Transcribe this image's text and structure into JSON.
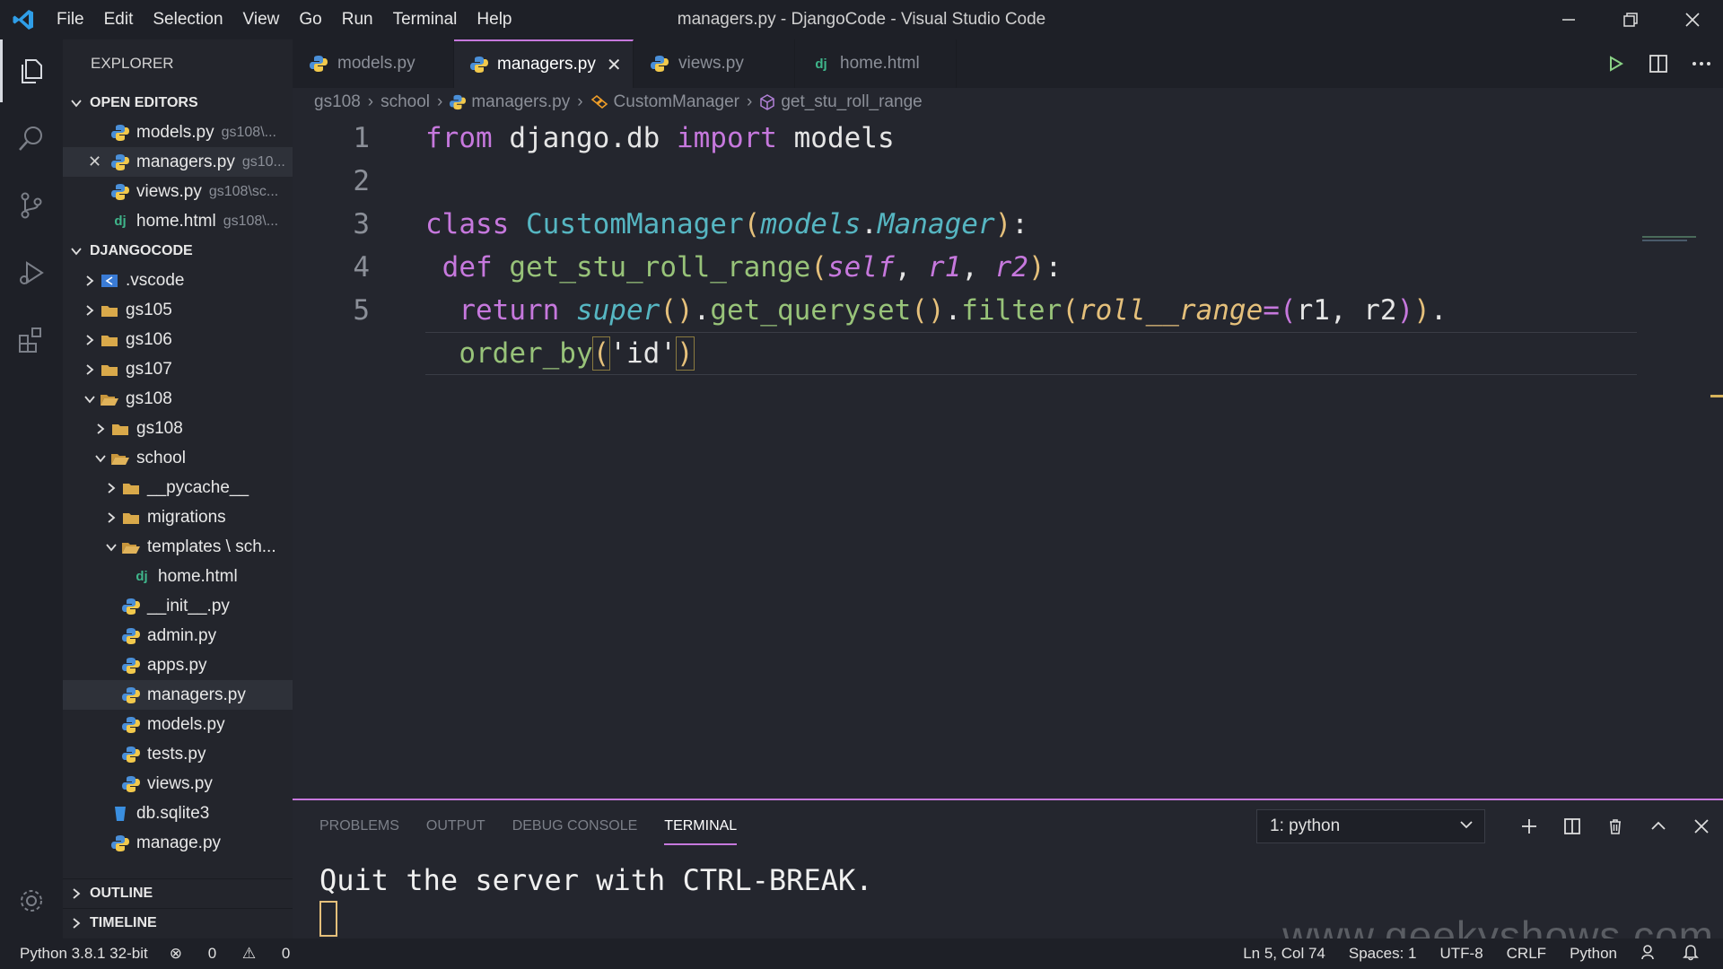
{
  "window": {
    "title": "managers.py - DjangoCode - Visual Studio Code",
    "menu": [
      "File",
      "Edit",
      "Selection",
      "View",
      "Go",
      "Run",
      "Terminal",
      "Help"
    ]
  },
  "sidebar": {
    "title": "EXPLORER",
    "open_editors": {
      "header": "OPEN EDITORS",
      "items": [
        {
          "name": "models.py",
          "desc": "gs108\\...",
          "icon": "python-icon"
        },
        {
          "name": "managers.py",
          "desc": "gs10...",
          "icon": "python-icon"
        },
        {
          "name": "views.py",
          "desc": "gs108\\sc...",
          "icon": "python-icon"
        },
        {
          "name": "home.html",
          "desc": "gs108\\...",
          "icon": "django-icon"
        }
      ]
    },
    "workspace": {
      "header": "DJANGOCODE",
      "items": [
        {
          "name": ".vscode",
          "type": "folder"
        },
        {
          "name": "gs105",
          "type": "folder"
        },
        {
          "name": "gs106",
          "type": "folder"
        },
        {
          "name": "gs107",
          "type": "folder"
        },
        {
          "name": "gs108",
          "type": "folder-open"
        },
        {
          "name": "gs108",
          "type": "folder"
        },
        {
          "name": "school",
          "type": "folder-open"
        },
        {
          "name": "__pycache__",
          "type": "folder"
        },
        {
          "name": "migrations",
          "type": "folder"
        },
        {
          "name": "templates \\ sch...",
          "type": "folder-open"
        },
        {
          "name": "home.html",
          "type": "django"
        },
        {
          "name": "__init__.py",
          "type": "python"
        },
        {
          "name": "admin.py",
          "type": "python"
        },
        {
          "name": "apps.py",
          "type": "python"
        },
        {
          "name": "managers.py",
          "type": "python"
        },
        {
          "name": "models.py",
          "type": "python"
        },
        {
          "name": "tests.py",
          "type": "python"
        },
        {
          "name": "views.py",
          "type": "python"
        },
        {
          "name": "db.sqlite3",
          "type": "db"
        },
        {
          "name": "manage.py",
          "type": "python"
        }
      ]
    },
    "outline": "OUTLINE",
    "timeline": "TIMELINE",
    "dj_glyph": "dj"
  },
  "tabs": [
    {
      "label": "models.py",
      "icon": "python-icon"
    },
    {
      "label": "managers.py",
      "icon": "python-icon",
      "active": true
    },
    {
      "label": "views.py",
      "icon": "python-icon"
    },
    {
      "label": "home.html",
      "icon": "django-icon"
    }
  ],
  "breadcrumb": [
    "gs108",
    "school",
    "managers.py",
    "CustomManager",
    "get_stu_roll_range"
  ],
  "editor": {
    "line_numbers": [
      "1",
      "2",
      "3",
      "4",
      "5"
    ],
    "code": {
      "l1_from": "from",
      "l1_mod": "django.db",
      "l1_import": "import",
      "l1_models": "models",
      "l3_class": "class",
      "l3_name": "CustomManager",
      "l3_open": "(",
      "l3_base1": "models",
      "l3_dot": ".",
      "l3_base2": "Manager",
      "l3_close": ")",
      "l3_colon": ":",
      "l4_def": "def",
      "l4_fn": "get_stu_roll_range",
      "l4_open": "(",
      "l4_self": "self",
      "l4_c1": ", ",
      "l4_r1": "r1",
      "l4_c2": ", ",
      "l4_r2": "r2",
      "l4_close": ")",
      "l4_colon": ":",
      "l5_return": "return",
      "l5_super": "super",
      "l5_p1": "()",
      "l5_dot1": ".",
      "l5_gq": "get_queryset",
      "l5_p2": "()",
      "l5_dot2": ".",
      "l5_filter": "filter",
      "l5_open": "(",
      "l5_kw": "roll__range",
      "l5_eq": "=",
      "l5_open2": "(",
      "l5_args": "r1, r2",
      "l5_close2": ")",
      "l5_close": ")",
      "l5_dot3": ".",
      "l6_fn": "order_by",
      "l6_open": "(",
      "l6_str": "'id'",
      "l6_close": ")"
    }
  },
  "panel": {
    "tabs": [
      "PROBLEMS",
      "OUTPUT",
      "DEBUG CONSOLE",
      "TERMINAL"
    ],
    "active_tab": "TERMINAL",
    "terminal_select": "1: python",
    "output": "Quit the server with CTRL-BREAK."
  },
  "statusbar": {
    "python": "Python 3.8.1 32-bit",
    "errors": "0",
    "warnings": "0",
    "position": "Ln 5, Col 74",
    "spaces": "Spaces: 1",
    "encoding": "UTF-8",
    "eol": "CRLF",
    "language": "Python"
  },
  "watermark": "www.geekyshows.com",
  "colors": {
    "accent": "#c678dd",
    "keyword": "#c678dd",
    "class": "#56b6c2",
    "function": "#98c379",
    "bracket": "#e5c07b"
  }
}
